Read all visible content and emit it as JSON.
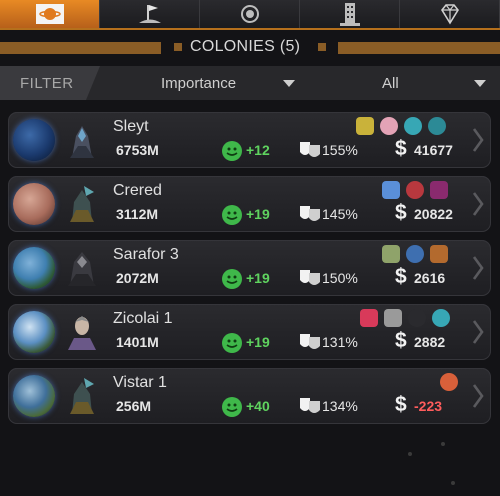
{
  "tabs": [
    {
      "name": "planet-tab",
      "icon": "planet-icon",
      "active": true
    },
    {
      "name": "flag-tab",
      "icon": "flag-icon",
      "active": false
    },
    {
      "name": "system-tab",
      "icon": "orbit-icon",
      "active": false
    },
    {
      "name": "building-tab",
      "icon": "building-icon",
      "active": false
    },
    {
      "name": "diamond-tab",
      "icon": "diamond-icon",
      "active": false
    }
  ],
  "header": {
    "title": "COLONIES (5)"
  },
  "filter": {
    "label": "FILTER",
    "sort_value": "Importance",
    "type_value": "All"
  },
  "colonies": [
    {
      "name": "Sleyt",
      "population": "6753M",
      "happiness": "+12",
      "approval": "155%",
      "income": "41677",
      "income_negative": false
    },
    {
      "name": "Crered",
      "population": "3112M",
      "happiness": "+19",
      "approval": "145%",
      "income": "20822",
      "income_negative": false
    },
    {
      "name": "Sarafor 3",
      "population": "2072M",
      "happiness": "+19",
      "approval": "150%",
      "income": "2616",
      "income_negative": false
    },
    {
      "name": "Zicolai 1",
      "population": "1401M",
      "happiness": "+19",
      "approval": "131%",
      "income": "2882",
      "income_negative": false
    },
    {
      "name": "Vistar 1",
      "population": "256M",
      "happiness": "+40",
      "approval": "134%",
      "income": "-223",
      "income_negative": true
    }
  ],
  "colors": {
    "accent": "#e08327",
    "happy_green": "#5fd35f",
    "negative_red": "#ff5c5c"
  }
}
